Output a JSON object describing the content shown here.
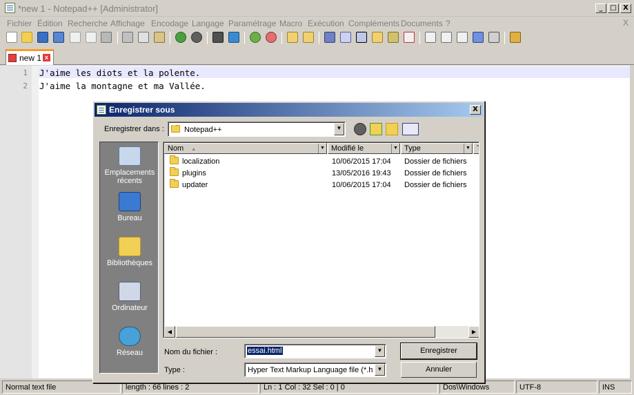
{
  "window": {
    "title": "*new 1 - Notepad++ [Administrator]",
    "min_glyph": "_",
    "max_glyph": "□",
    "close_glyph": "X"
  },
  "menu": {
    "items": [
      "Fichier",
      "Édition",
      "Recherche",
      "Affichage",
      "Encodage",
      "Langage",
      "Paramétrage",
      "Macro",
      "Exécution",
      "Compléments",
      "Documents",
      "?"
    ],
    "close": "X"
  },
  "tab": {
    "label": "new 1",
    "close": "x"
  },
  "editor": {
    "lines": [
      {
        "num": "1",
        "text": "J'aime les diots et la polente."
      },
      {
        "num": "2",
        "text": "J'aime la montagne et ma Vallée."
      }
    ]
  },
  "statusbar": {
    "type": "Normal text file",
    "length": "length : 66    lines : 2",
    "position": "Ln : 1    Col : 32    Sel : 0 | 0",
    "eol": "Dos\\Windows",
    "encoding": "UTF-8",
    "mode": "INS"
  },
  "dialog": {
    "title": "Enregistrer sous",
    "close": "X",
    "save_in_label": "Enregistrer dans :",
    "save_in_value": "Notepad++",
    "places": [
      {
        "label": "Emplacements récents",
        "icon": "recent-places-icon"
      },
      {
        "label": "Bureau",
        "icon": "desktop-icon"
      },
      {
        "label": "Bibliothèques",
        "icon": "libraries-icon"
      },
      {
        "label": "Ordinateur",
        "icon": "computer-icon"
      },
      {
        "label": "Réseau",
        "icon": "network-icon"
      }
    ],
    "columns": [
      "Nom",
      "Modifié le",
      "Type",
      "T"
    ],
    "files": [
      {
        "name": "localization",
        "date": "10/06/2015 17:04",
        "type": "Dossier de fichiers"
      },
      {
        "name": "plugins",
        "date": "13/05/2016 19:43",
        "type": "Dossier de fichiers"
      },
      {
        "name": "updater",
        "date": "10/06/2015 17:04",
        "type": "Dossier de fichiers"
      }
    ],
    "filename_label": "Nom du fichier :",
    "filename_value": "essai.html",
    "type_label": "Type :",
    "type_value": "Hyper Text Markup Language file (*.htm",
    "save_button": "Enregistrer",
    "cancel_button": "Annuler"
  },
  "colors": {
    "tab_accent": "#fa9a28",
    "current_line": "#e8e8ff",
    "selection": "#0a246a",
    "dialog_title_start": "#0a246a",
    "dialog_title_end": "#a6caf0"
  }
}
